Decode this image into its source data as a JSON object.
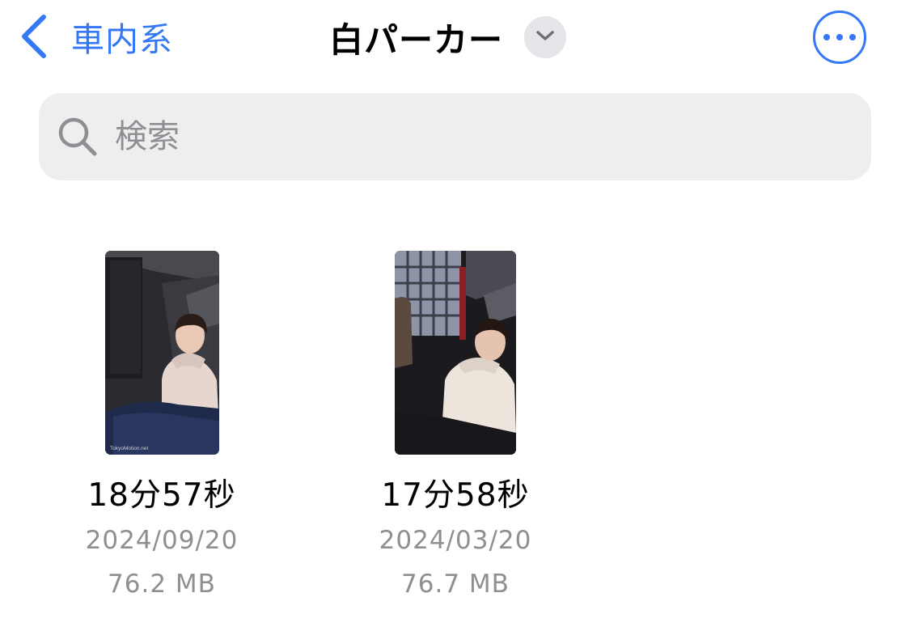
{
  "nav": {
    "back_label": "車内系",
    "back_icon": "chevron-left-icon",
    "title": "白パーカー",
    "title_menu_icon": "chevron-down-icon",
    "more_icon": "ellipsis-circle-icon"
  },
  "search": {
    "placeholder": "検索",
    "value": "",
    "icon": "magnifying-glass-icon"
  },
  "files": [
    {
      "name": "18分57秒",
      "date": "2024/09/20",
      "size": "76.2 MB",
      "thumbnail": "video-thumbnail-car-interior",
      "watermark": "TokyoMotion.net"
    },
    {
      "name": "17分58秒",
      "date": "2024/03/20",
      "size": "76.7 MB",
      "thumbnail": "video-thumbnail-car-interior"
    }
  ],
  "colors": {
    "accent": "#3478f6",
    "secondary_text": "#8e8e93",
    "search_background": "#eeeeef",
    "chip_background": "#e5e5ea"
  }
}
